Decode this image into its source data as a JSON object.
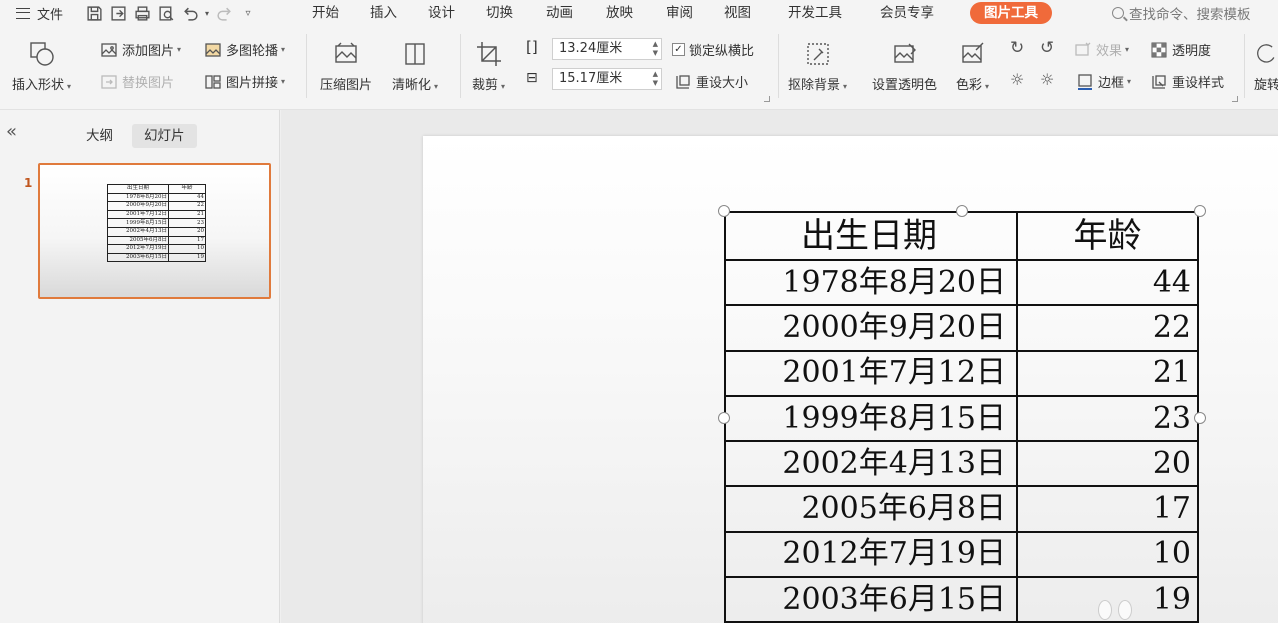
{
  "menubar": {
    "file_label": "文件",
    "tabs": [
      {
        "label": "开始"
      },
      {
        "label": "插入"
      },
      {
        "label": "设计"
      },
      {
        "label": "切换"
      },
      {
        "label": "动画"
      },
      {
        "label": "放映"
      },
      {
        "label": "审阅"
      },
      {
        "label": "视图"
      },
      {
        "label": "开发工具"
      },
      {
        "label": "会员专享"
      },
      {
        "label": "图片工具"
      }
    ],
    "active_tab": "图片工具",
    "search_placeholder": "查找命令、搜索模板"
  },
  "ribbon": {
    "insert_shape": "插入形状",
    "add_picture": "添加图片",
    "replace_picture": "替换图片",
    "multi_carousel": "多图轮播",
    "picture_collage": "图片拼接",
    "compress_picture": "压缩图片",
    "sharpen": "清晰化",
    "crop": "裁剪",
    "height_value": "13.24厘米",
    "width_value": "15.17厘米",
    "lock_aspect": "锁定纵横比",
    "reset_size": "重设大小",
    "remove_background": "抠除背景",
    "set_transparent_color": "设置透明色",
    "color": "色彩",
    "effects": "效果",
    "transparency": "透明度",
    "border": "边框",
    "reset_style": "重设样式",
    "rotate": "旋转"
  },
  "leftpanel": {
    "tab_outline": "大纲",
    "tab_slides": "幻灯片",
    "slide_number": "1"
  },
  "table": {
    "headers": [
      "出生日期",
      "年龄"
    ],
    "rows": [
      [
        "1978年8月20日",
        "44"
      ],
      [
        "2000年9月20日",
        "22"
      ],
      [
        "2001年7月12日",
        "21"
      ],
      [
        "1999年8月15日",
        "23"
      ],
      [
        "2002年4月13日",
        "20"
      ],
      [
        "2005年6月8日",
        "17"
      ],
      [
        "2012年7月19日",
        "10"
      ],
      [
        "2003年6月15日",
        "19"
      ]
    ]
  },
  "colors": {
    "accent": "#f06a3a",
    "thumb_border": "#e07a3c"
  }
}
